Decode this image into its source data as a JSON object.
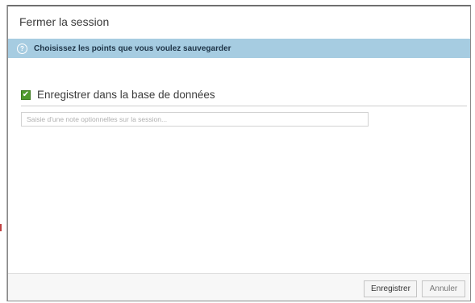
{
  "dialog": {
    "title": "Fermer la session",
    "banner": {
      "icon": "info-circle-icon",
      "text": "Choisissez les points que vous voulez sauvegarder",
      "color": "#a6cce1"
    },
    "option": {
      "checked": true,
      "label": "Enregistrer dans la base de données",
      "checkbox_color": "#4f9a2d"
    },
    "note_input": {
      "value": "",
      "placeholder": "Saisie d'une note optionnelles sur la session..."
    },
    "footer": {
      "save_label": "Enregistrer",
      "cancel_label": "Annuler"
    }
  }
}
